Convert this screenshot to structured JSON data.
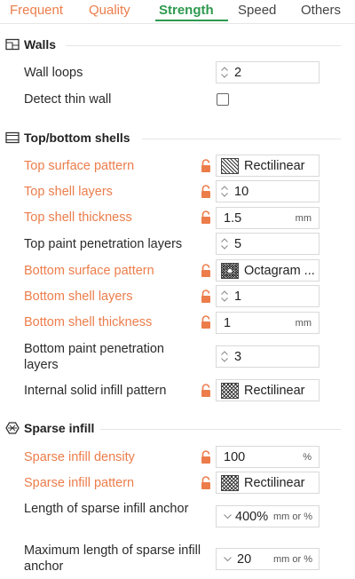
{
  "tabs": [
    "Frequent",
    "Quality",
    "Strength",
    "Speed",
    "Others"
  ],
  "sections": {
    "walls": "Walls",
    "top_bottom": "Top/bottom shells",
    "sparse": "Sparse infill"
  },
  "rows": {
    "wall_loops": {
      "label": "Wall loops",
      "value": "2"
    },
    "detect_thin_wall": {
      "label": "Detect thin wall",
      "checked": false
    },
    "top_surface_pattern": {
      "label": "Top surface pattern",
      "value": "Rectilinear"
    },
    "top_shell_layers": {
      "label": "Top shell layers",
      "value": "10"
    },
    "top_shell_thickness": {
      "label": "Top shell thickness",
      "value": "1.5",
      "unit": "mm"
    },
    "top_paint_penetration": {
      "label": "Top paint penetration layers",
      "value": "5"
    },
    "bottom_surface_pattern": {
      "label": "Bottom surface pattern",
      "value": "Octagram ..."
    },
    "bottom_shell_layers": {
      "label": "Bottom shell layers",
      "value": "1"
    },
    "bottom_shell_thickness": {
      "label": "Bottom shell thickness",
      "value": "1",
      "unit": "mm"
    },
    "bottom_paint_penetration": {
      "label": "Bottom paint penetration layers",
      "value": "3"
    },
    "internal_solid_infill": {
      "label": "Internal solid infill pattern",
      "value": "Rectilinear"
    },
    "sparse_density": {
      "label": "Sparse infill density",
      "value": "100",
      "unit": "%"
    },
    "sparse_pattern": {
      "label": "Sparse infill pattern",
      "value": "Rectilinear"
    },
    "sparse_anchor": {
      "label": "Length of sparse infill anchor",
      "value": "400%",
      "unit": "mm or %"
    },
    "sparse_anchor_max": {
      "label": "Maximum length of sparse infill anchor",
      "value": "20",
      "unit": "mm or %"
    }
  },
  "colors": {
    "modified": "#ec7d4b",
    "active_tab": "#2e9a4e"
  }
}
